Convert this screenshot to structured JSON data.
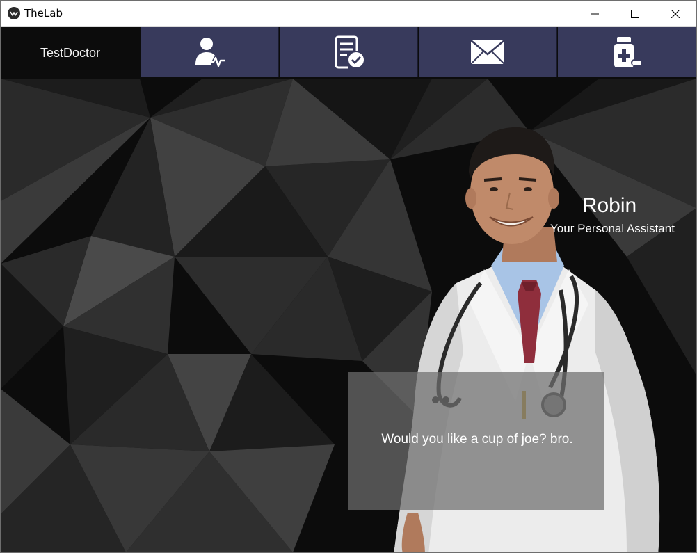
{
  "window": {
    "title": "TheLab",
    "controls": [
      "minimize",
      "maximize",
      "close"
    ]
  },
  "header": {
    "username": "TestDoctor",
    "tabs": [
      {
        "icon": "patient-vitals-icon"
      },
      {
        "icon": "checked-document-icon"
      },
      {
        "icon": "mail-envelope-icon"
      },
      {
        "icon": "medicine-bottle-icon"
      }
    ]
  },
  "assistant": {
    "name": "Robin",
    "role": "Your Personal Assistant",
    "message": "Would you like a cup of joe? bro."
  },
  "colors": {
    "tab_background": "#383a5c",
    "background": "#0b0b0b",
    "speech_box": "#6e6e6e"
  }
}
